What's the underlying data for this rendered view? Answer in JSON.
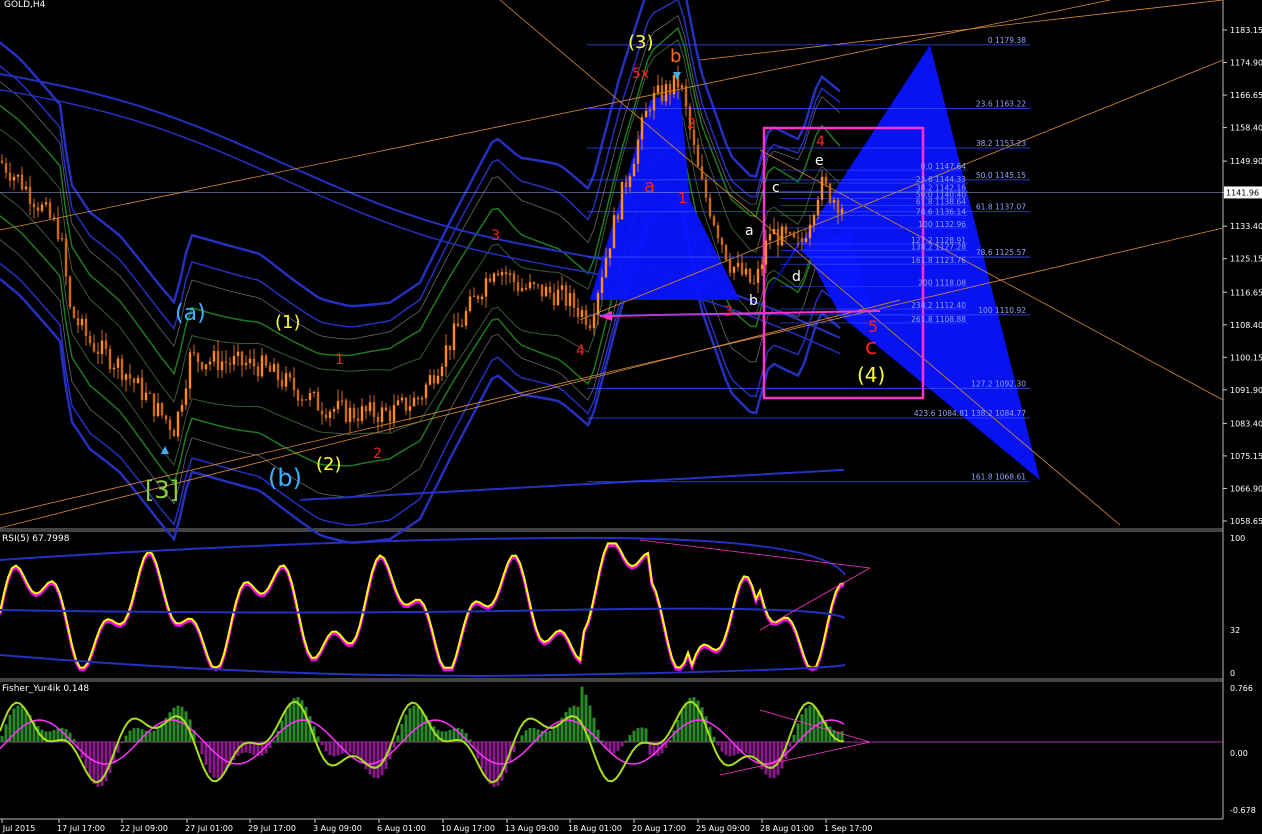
{
  "header": {
    "symbol": "GOLD,H4"
  },
  "colors": {
    "background": "#000000",
    "axis": "#ffffff",
    "bull_candle": "#ff8c1a",
    "bear_candle": "#ff8c1a",
    "fib_lines": "#3a4cff",
    "pattern_fill": "#0a14ff",
    "rsi_line": "#ffff00",
    "rsi_shadow": "#ff00ff",
    "fisher_line": "#aadd22",
    "fisher_signal": "#ff33ff",
    "hist_pos": "#2a8a2a",
    "hist_neg": "#8a1a8a",
    "box": "#ff33cc",
    "wave_yellow": "#ffff33",
    "wave_cyan": "#3fb0ff",
    "wave_red": "#ff2020"
  },
  "chart_data": [
    {
      "type": "line",
      "title": "GOLD,H4",
      "ylim": [
        1056.5,
        1187.5
      ],
      "y_ticks": [
        "1183.15",
        "1174.90",
        "1166.65",
        "1158.40",
        "1149.90",
        "1141.96",
        "1133.40",
        "1125.15",
        "1116.65",
        "1108.40",
        "1100.15",
        "1091.90",
        "1083.40",
        "1075.15",
        "1066.90",
        "1058.65"
      ],
      "current_price": "1141.96",
      "x_ticks": [
        "16 Jul 2015",
        "17 Jul 17:00",
        "22 Jul 09:00",
        "27 Jul 01:00",
        "29 Jul 17:00",
        "3 Aug 09:00",
        "6 Aug 01:00",
        "10 Aug 17:00",
        "13 Aug 09:00",
        "18 Aug 01:00",
        "20 Aug 17:00",
        "25 Aug 09:00",
        "28 Aug 01:00",
        "1 Sep 17:00"
      ],
      "fib_levels": [
        {
          "label": "0 1179.38",
          "price": 1179.38
        },
        {
          "label": "23.6 1163.22",
          "price": 1163.22
        },
        {
          "label": "38.2 1153.23",
          "price": 1153.23
        },
        {
          "label": "50.0 1145.15",
          "price": 1145.15
        },
        {
          "label": "61.8 1137.07",
          "price": 1137.07
        },
        {
          "label": "78.6 1125.57",
          "price": 1125.57
        },
        {
          "label": "100 1110.92",
          "price": 1110.92
        },
        {
          "label": "127.2 1092.30",
          "price": 1092.3
        },
        {
          "label": "423.6 1084.81 138.2 1084.77",
          "price": 1084.77
        },
        {
          "label": "161.8 1068.61",
          "price": 1068.61
        }
      ],
      "fib_levels_small": [
        {
          "label": "0.0 1147.64",
          "price": 1147.64
        },
        {
          "label": "23.6 1144.33",
          "price": 1144.33
        },
        {
          "label": "38.2 1142.16",
          "price": 1142.16
        },
        {
          "label": "50.0 1140.40",
          "price": 1140.4
        },
        {
          "label": "61.8 1138.64",
          "price": 1138.64
        },
        {
          "label": "78.6 1136.14",
          "price": 1136.14
        },
        {
          "label": "100 1132.96",
          "price": 1132.96
        },
        {
          "label": "127.2 1128.91",
          "price": 1128.91
        },
        {
          "label": "138.2 1127.28",
          "price": 1127.28
        },
        {
          "label": "161.8 1123.76",
          "price": 1123.76
        },
        {
          "label": "200 1118.08",
          "price": 1118.08
        },
        {
          "label": "238.2 1112.40",
          "price": 1112.4
        },
        {
          "label": "261.8 1108.88",
          "price": 1108.88
        }
      ],
      "wave_labels": [
        {
          "text": "(3)",
          "color": "yellow"
        },
        {
          "text": "b",
          "color": "orange"
        },
        {
          "text": "5x",
          "color": "red"
        },
        {
          "text": "2",
          "color": "red"
        },
        {
          "text": "a",
          "color": "red"
        },
        {
          "text": "1",
          "color": "red"
        },
        {
          "text": "3",
          "color": "red"
        },
        {
          "text": "4",
          "color": "red"
        },
        {
          "text": "(a)",
          "color": "cyan"
        },
        {
          "text": "(1)",
          "color": "yellow"
        },
        {
          "text": "1",
          "color": "red"
        },
        {
          "text": "[3]",
          "color": "green"
        },
        {
          "text": "(b)",
          "color": "cyan"
        },
        {
          "text": "(2)",
          "color": "yellow"
        },
        {
          "text": "2",
          "color": "red"
        },
        {
          "text": "4",
          "color": "red"
        },
        {
          "text": "e",
          "color": "white"
        },
        {
          "text": "c",
          "color": "white"
        },
        {
          "text": "a",
          "color": "white"
        },
        {
          "text": "d",
          "color": "white"
        },
        {
          "text": "b",
          "color": "white"
        },
        {
          "text": "3",
          "color": "red"
        },
        {
          "text": "5",
          "color": "red"
        },
        {
          "text": "c",
          "color": "red"
        },
        {
          "text": "(4)",
          "color": "yellow"
        }
      ]
    },
    {
      "type": "line",
      "title": "RSI(5) 67.7998",
      "ylim": [
        0,
        100
      ],
      "y_ticks": [
        "100",
        "32",
        "0"
      ]
    },
    {
      "type": "line",
      "title": "Fisher_Yur4ik 0.148",
      "ylim": [
        -0.678,
        0.766
      ],
      "y_ticks": [
        "0.766",
        "0.00",
        "-0.678"
      ]
    }
  ]
}
